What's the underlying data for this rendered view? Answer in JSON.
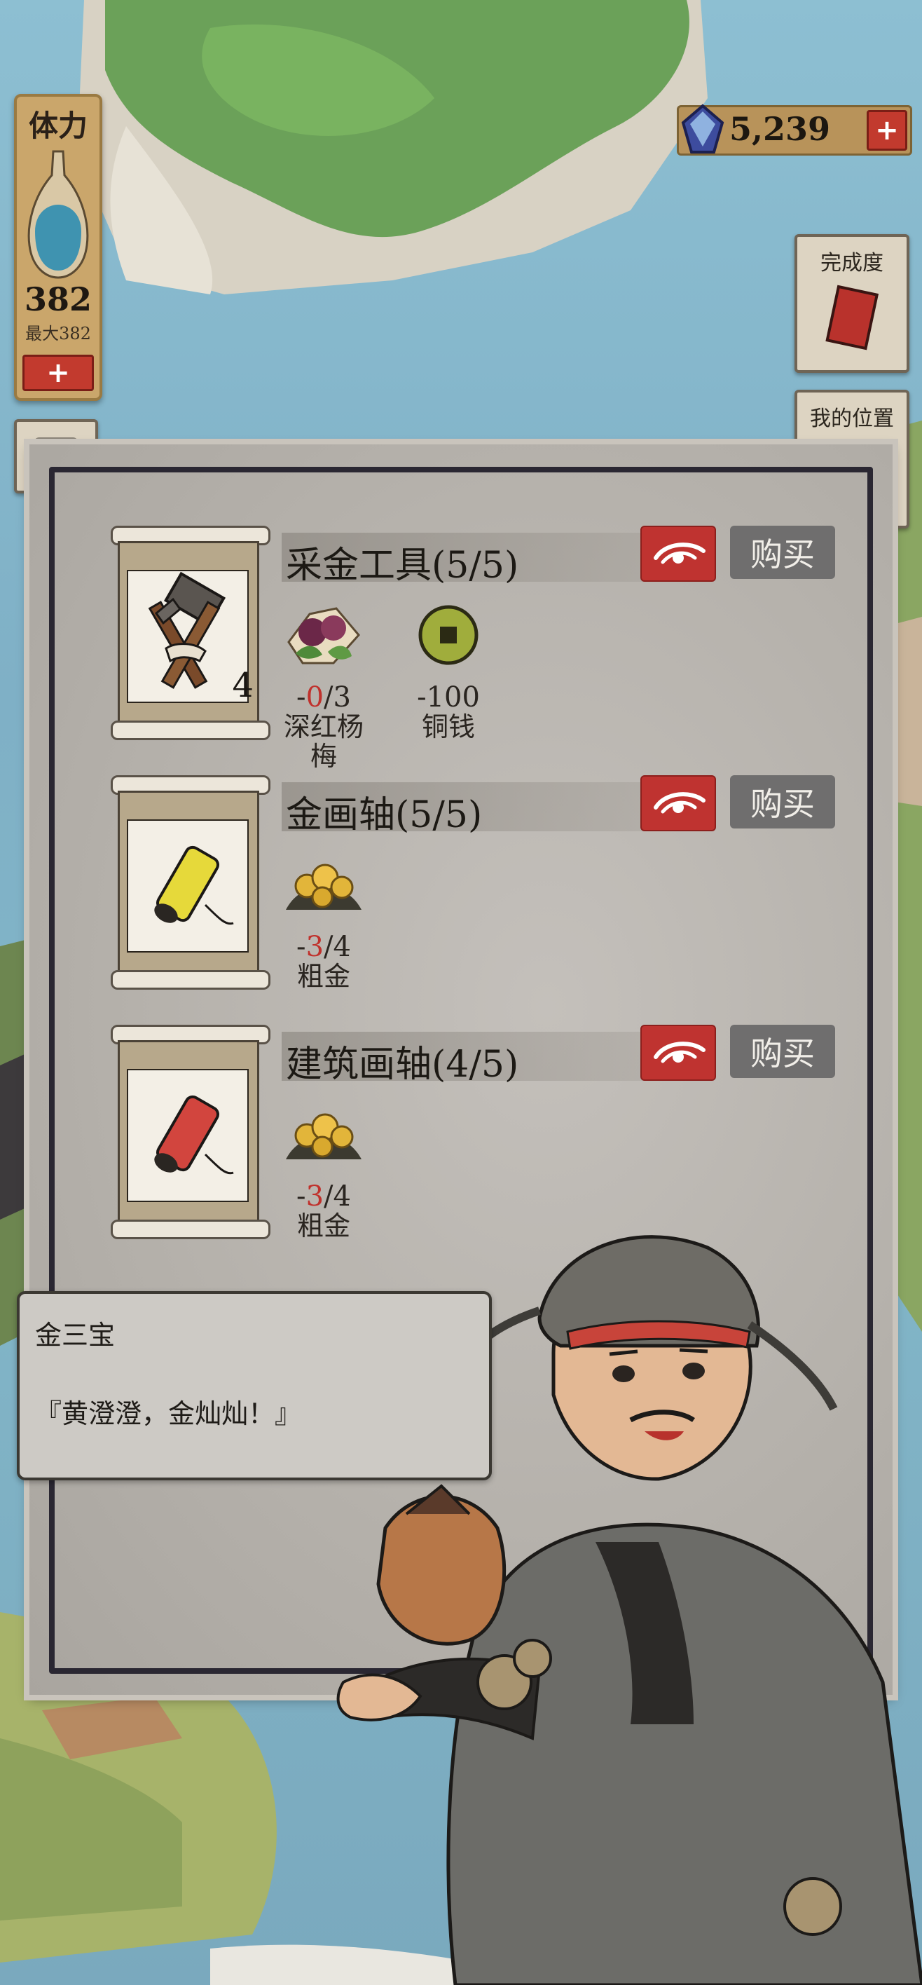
{
  "stamina": {
    "label": "体力",
    "value": "382",
    "max": "最大382",
    "add_label": "+"
  },
  "currency": {
    "value": "5,239",
    "add_label": "+"
  },
  "side": {
    "completion_label": "完成度",
    "location_label": "我的位置"
  },
  "shop": {
    "items": [
      {
        "name": "采金工具(5/5)",
        "count": "4",
        "icon": "hammer-pick-icon",
        "buy_label": "购买",
        "requirements": [
          {
            "prefix": "-",
            "amount_neg": "0",
            "amount_rest": "/3",
            "name": "深红杨梅",
            "icon": "bayberry-icon"
          },
          {
            "prefix": "",
            "amount_neg": "",
            "amount_rest": "-100",
            "name": "铜钱",
            "icon": "copper-coin-icon"
          }
        ]
      },
      {
        "name": "金画轴(5/5)",
        "count": "",
        "icon": "gold-scroll-icon",
        "buy_label": "购买",
        "requirements": [
          {
            "prefix": "-",
            "amount_neg": "3",
            "amount_rest": "/4",
            "name": "粗金",
            "icon": "gold-ore-icon"
          }
        ]
      },
      {
        "name": "建筑画轴(4/5)",
        "count": "",
        "icon": "red-scroll-icon",
        "buy_label": "购买",
        "requirements": [
          {
            "prefix": "-",
            "amount_neg": "3",
            "amount_rest": "/4",
            "name": "粗金",
            "icon": "gold-ore-icon"
          }
        ]
      }
    ]
  },
  "dialog": {
    "speaker": "金三宝",
    "text": "『黄澄澄，金灿灿！』"
  },
  "colors": {
    "accent_red": "#bf3330",
    "panel": "#b4b0aa",
    "buy": "#6f6e6e"
  }
}
